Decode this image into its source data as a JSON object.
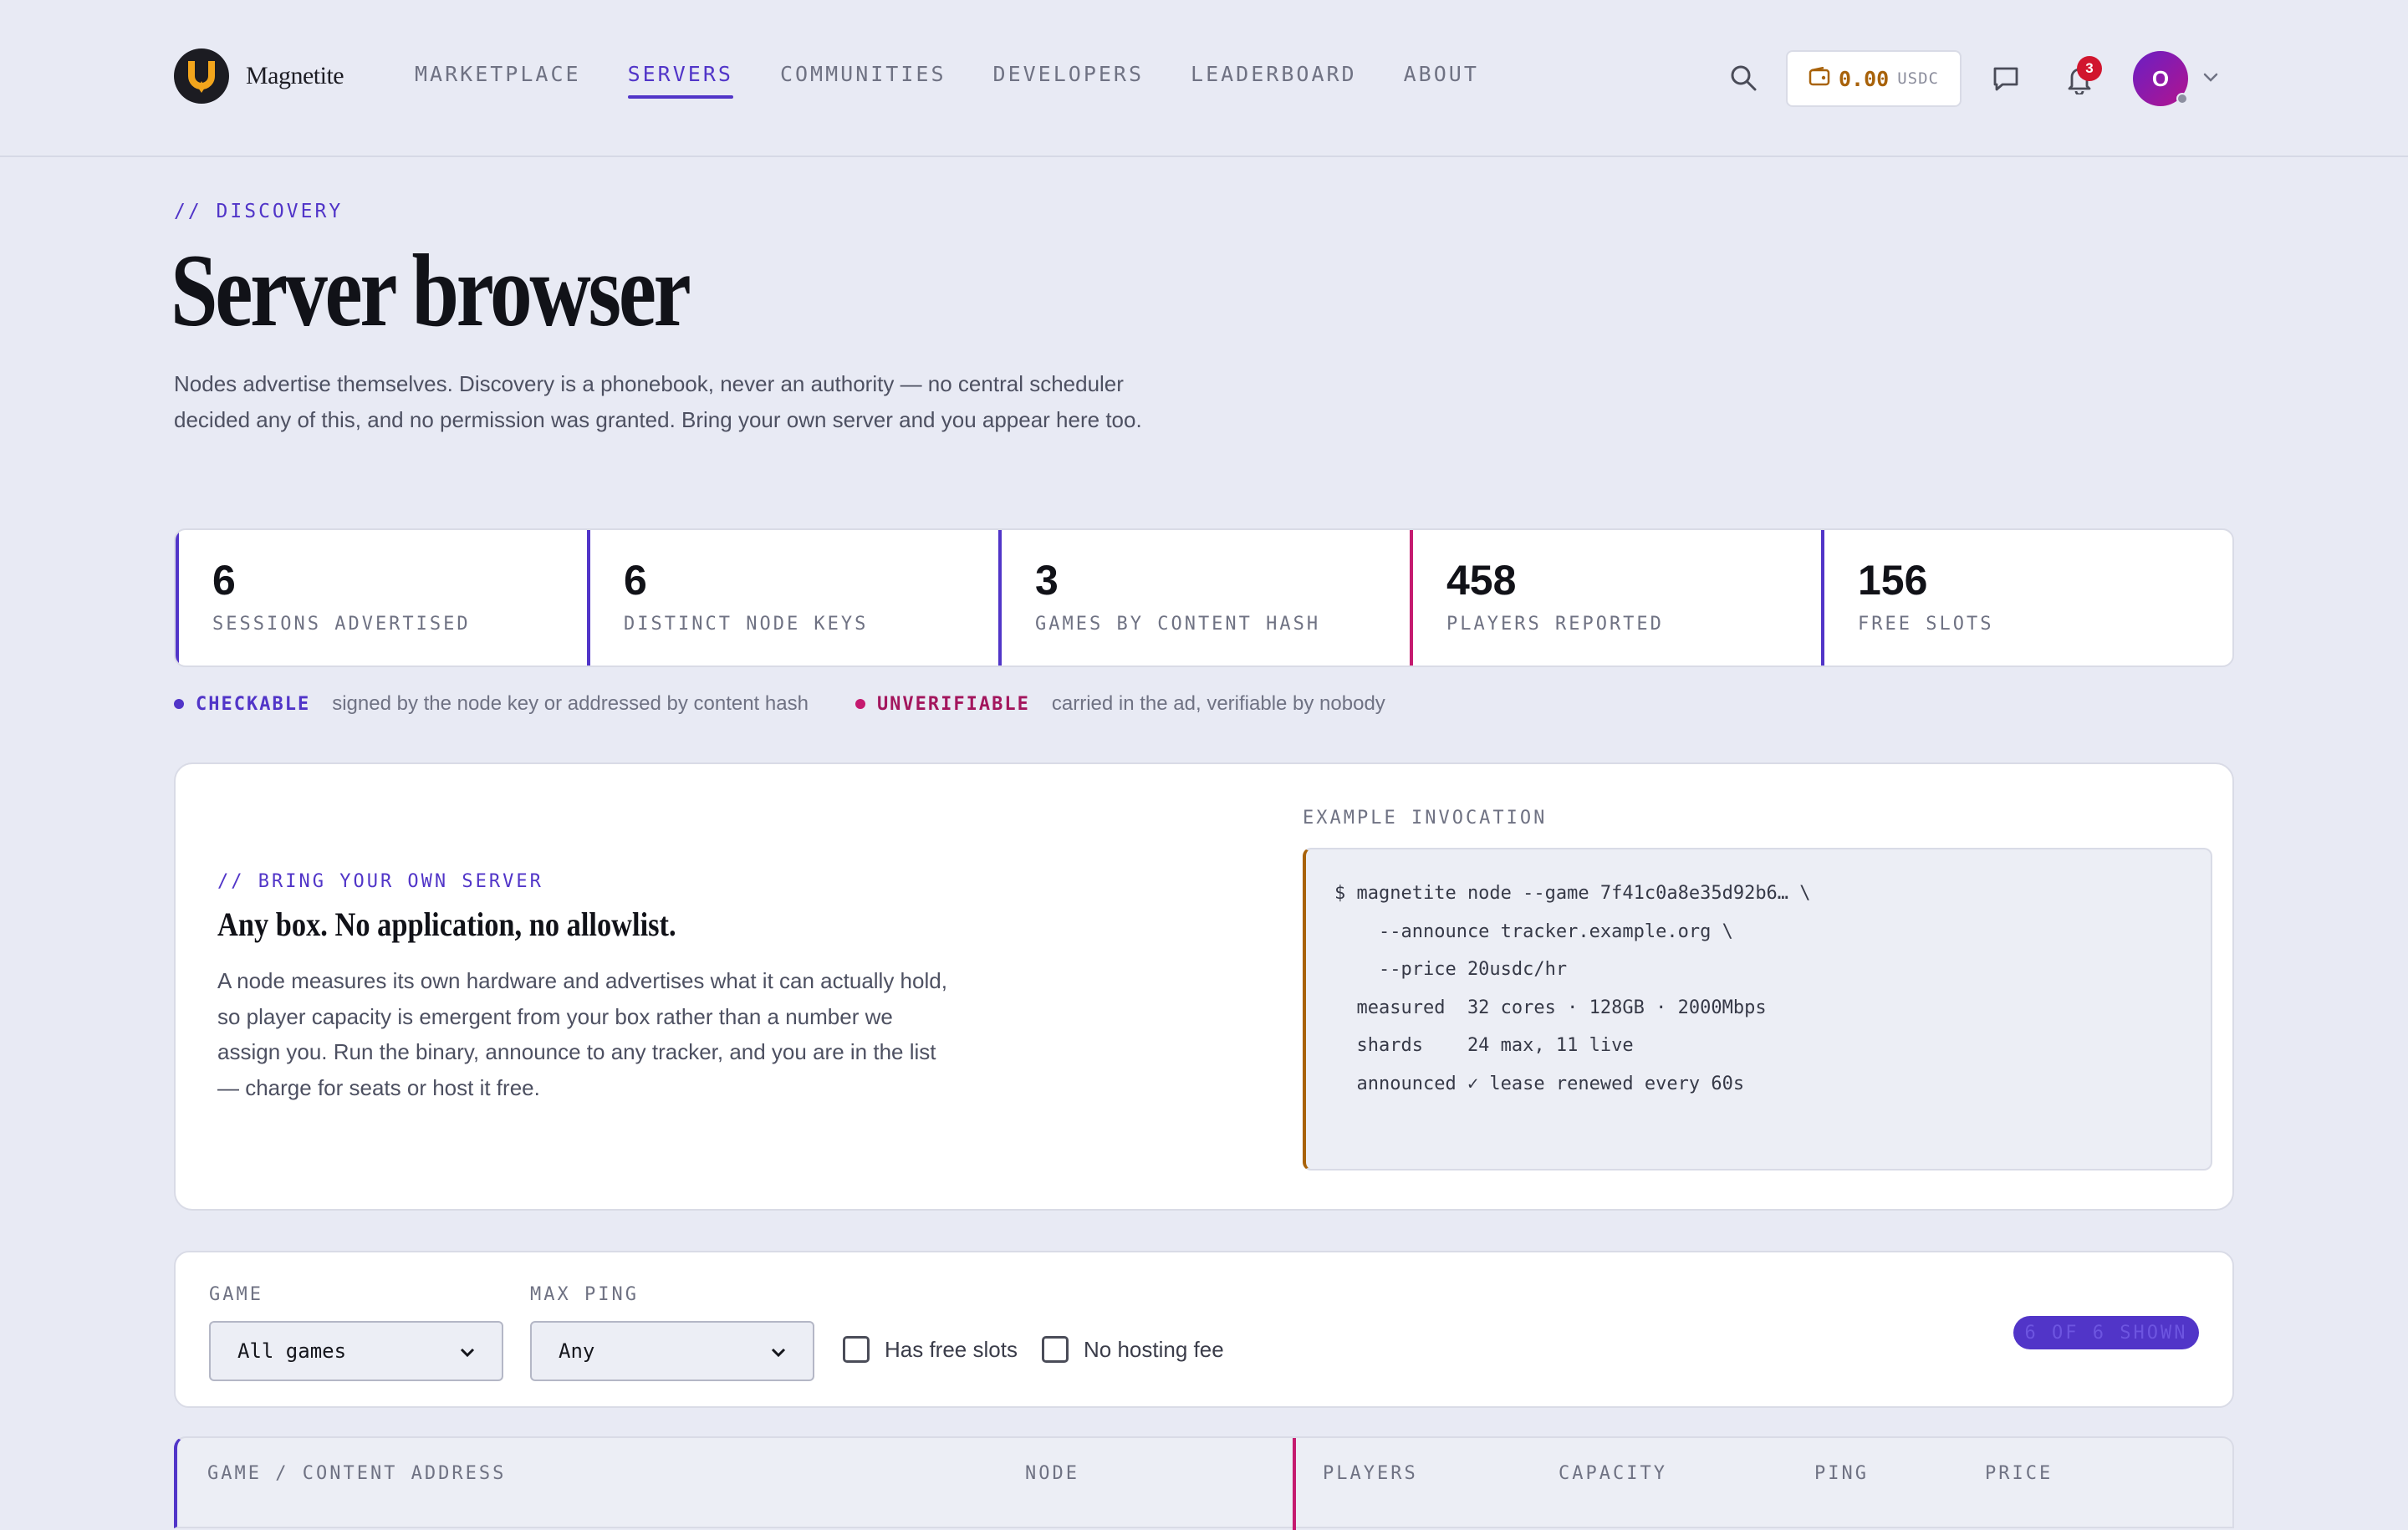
{
  "brand": {
    "name": "Magnetite",
    "colors": {
      "accent": "#5135c8",
      "warn": "#a8620a",
      "pink": "#c51a6f",
      "background": "#e8eaf4"
    }
  },
  "nav": {
    "items": [
      {
        "label": "MARKETPLACE",
        "active": false
      },
      {
        "label": "SERVERS",
        "active": true
      },
      {
        "label": "COMMUNITIES",
        "active": false
      },
      {
        "label": "DEVELOPERS",
        "active": false
      },
      {
        "label": "LEADERBOARD",
        "active": false
      },
      {
        "label": "ABOUT",
        "active": false
      }
    ]
  },
  "toolbar": {
    "wallet_amount": "0.00",
    "wallet_unit": "USDC",
    "notification_count": "3",
    "avatar_initial": "O"
  },
  "header": {
    "eyebrow": "// DISCOVERY",
    "title": "Server browser",
    "lede": "Nodes advertise themselves. Discovery is a phonebook, never an authority — no central scheduler decided any of this, and no permission was granted. Bring your own server and you appear here too."
  },
  "stats": [
    {
      "value": "6",
      "label": "SESSIONS ADVERTISED"
    },
    {
      "value": "6",
      "label": "DISTINCT NODE KEYS"
    },
    {
      "value": "3",
      "label": "GAMES BY CONTENT HASH"
    },
    {
      "value": "458",
      "label": "PLAYERS REPORTED"
    },
    {
      "value": "156",
      "label": "FREE SLOTS"
    }
  ],
  "legend": {
    "checkable_key": "CHECKABLE",
    "checkable_desc": "signed by the node key or addressed by content hash",
    "unverifiable_key": "UNVERIFIABLE",
    "unverifiable_desc": "carried in the ad, verifiable by nobody"
  },
  "byos": {
    "eyebrow": "// BRING YOUR OWN SERVER",
    "title": "Any box. No application, no allowlist.",
    "body": "A node measures its own hardware and advertises what it can actually hold, so player capacity is emergent from your box rather than a number we assign you. Run the binary, announce to any tracker, and you are in the list — charge for seats or host it free.",
    "example_label": "EXAMPLE INVOCATION",
    "code_lines": [
      "$ magnetite node --game 7f41c0a8e35d92b6… \\",
      "    --announce tracker.example.org \\",
      "    --price 20usdc/hr",
      "",
      "  measured  32 cores · 128GB · 2000Mbps",
      "  shards    24 max, 11 live",
      "  announced ✓ lease renewed every 60s"
    ]
  },
  "filters": {
    "game_label": "GAME",
    "game_value": "All games",
    "ping_label": "MAX PING",
    "ping_value": "Any",
    "free_slots_label": "Has free slots",
    "no_fee_label": "No hosting fee",
    "shown_text": "6 OF 6 SHOWN"
  },
  "table": {
    "headers": [
      "GAME / CONTENT ADDRESS",
      "NODE",
      "PLAYERS",
      "CAPACITY",
      "PING",
      "PRICE"
    ]
  }
}
